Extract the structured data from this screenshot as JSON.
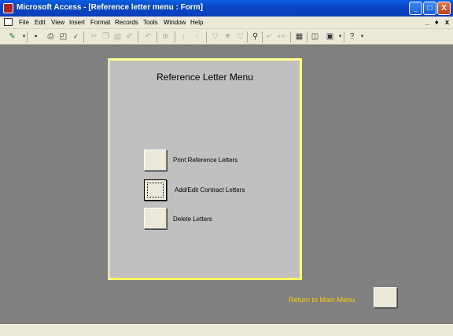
{
  "window": {
    "title": "Microsoft Access - [Reference letter menu : Form]",
    "minimize_glyph": "_",
    "maximize_glyph": "□",
    "close_glyph": "X"
  },
  "menubar": {
    "items": [
      "File",
      "Edit",
      "View",
      "Insert",
      "Format",
      "Records",
      "Tools",
      "Window",
      "Help"
    ],
    "mdi_controls": [
      "_",
      "♦",
      "x"
    ]
  },
  "toolbar": {
    "icons": [
      "design-view-icon",
      "dropdown-arrow-icon",
      "save-icon",
      "print-icon",
      "print-preview-icon",
      "spelling-icon",
      "cut-icon",
      "copy-icon",
      "paste-icon",
      "format-painter-icon",
      "undo-icon",
      "insert-hyperlink-icon",
      "sort-ascending-icon",
      "sort-descending-icon",
      "filter-by-selection-icon",
      "filter-by-form-icon",
      "apply-filter-icon",
      "find-icon",
      "new-record-icon",
      "delete-record-icon",
      "properties-icon",
      "database-window-icon",
      "new-object-icon",
      "help-icon"
    ]
  },
  "form": {
    "title": "Reference Letter Menu",
    "buttons": [
      {
        "label": "Print Reference Letters"
      },
      {
        "label": "Add/Edit Contract Letters"
      },
      {
        "label": "Delete Letters"
      }
    ]
  },
  "return_label": "Return to Main Menu",
  "colors": {
    "title_bar": "#0a4fd8",
    "mdi_background": "#808080",
    "form_background": "#c0c0c0",
    "form_border": "#ffff66",
    "return_label": "#ffcc00"
  }
}
